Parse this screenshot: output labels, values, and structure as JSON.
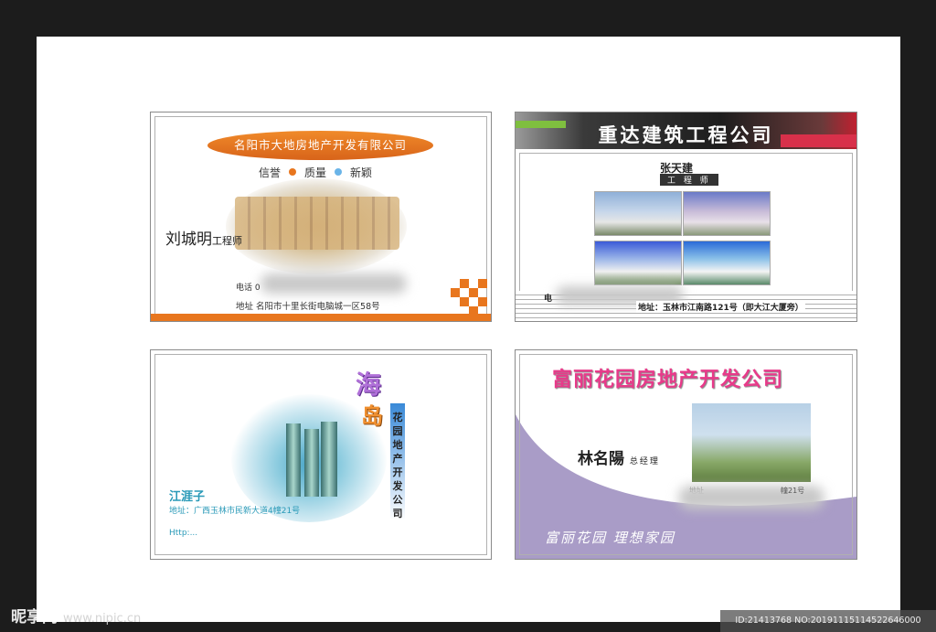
{
  "colors": {
    "orange": "#e8761e",
    "purple": "#a99cc7",
    "teal": "#2a9ab8"
  },
  "card1": {
    "company": "名阳市大地房地产开发有限公司",
    "slogan": [
      "信誉",
      "质量",
      "新颖"
    ],
    "name": "刘城明",
    "title": "工程师",
    "tel": "电话  0",
    "address": "地址  名阳市十里长街电脑城一区58号"
  },
  "card2": {
    "company": "重达建筑工程公司",
    "name": "张天建",
    "title": "工 程 师",
    "tel": "电",
    "address": "地址：玉林市江南路121号（即大江大厦旁）"
  },
  "card3": {
    "brand_1": "海",
    "brand_2": "岛",
    "vertical": "花园地产开发公司",
    "name": "江涯子",
    "address": "地址：广西玉林市民新大道4幢21号",
    "http": "Http:..."
  },
  "card4": {
    "company": "富丽花园房地产开发公司",
    "name": "林名陽",
    "title": "总经理",
    "address": "地址",
    "address_end": "幢21号",
    "slogan": "富丽花园   理想家园"
  },
  "watermark": {
    "logo": "昵享网",
    "url": "www.nipic.cn"
  },
  "id_text": "ID:21413768 NO:20191115114522646000"
}
